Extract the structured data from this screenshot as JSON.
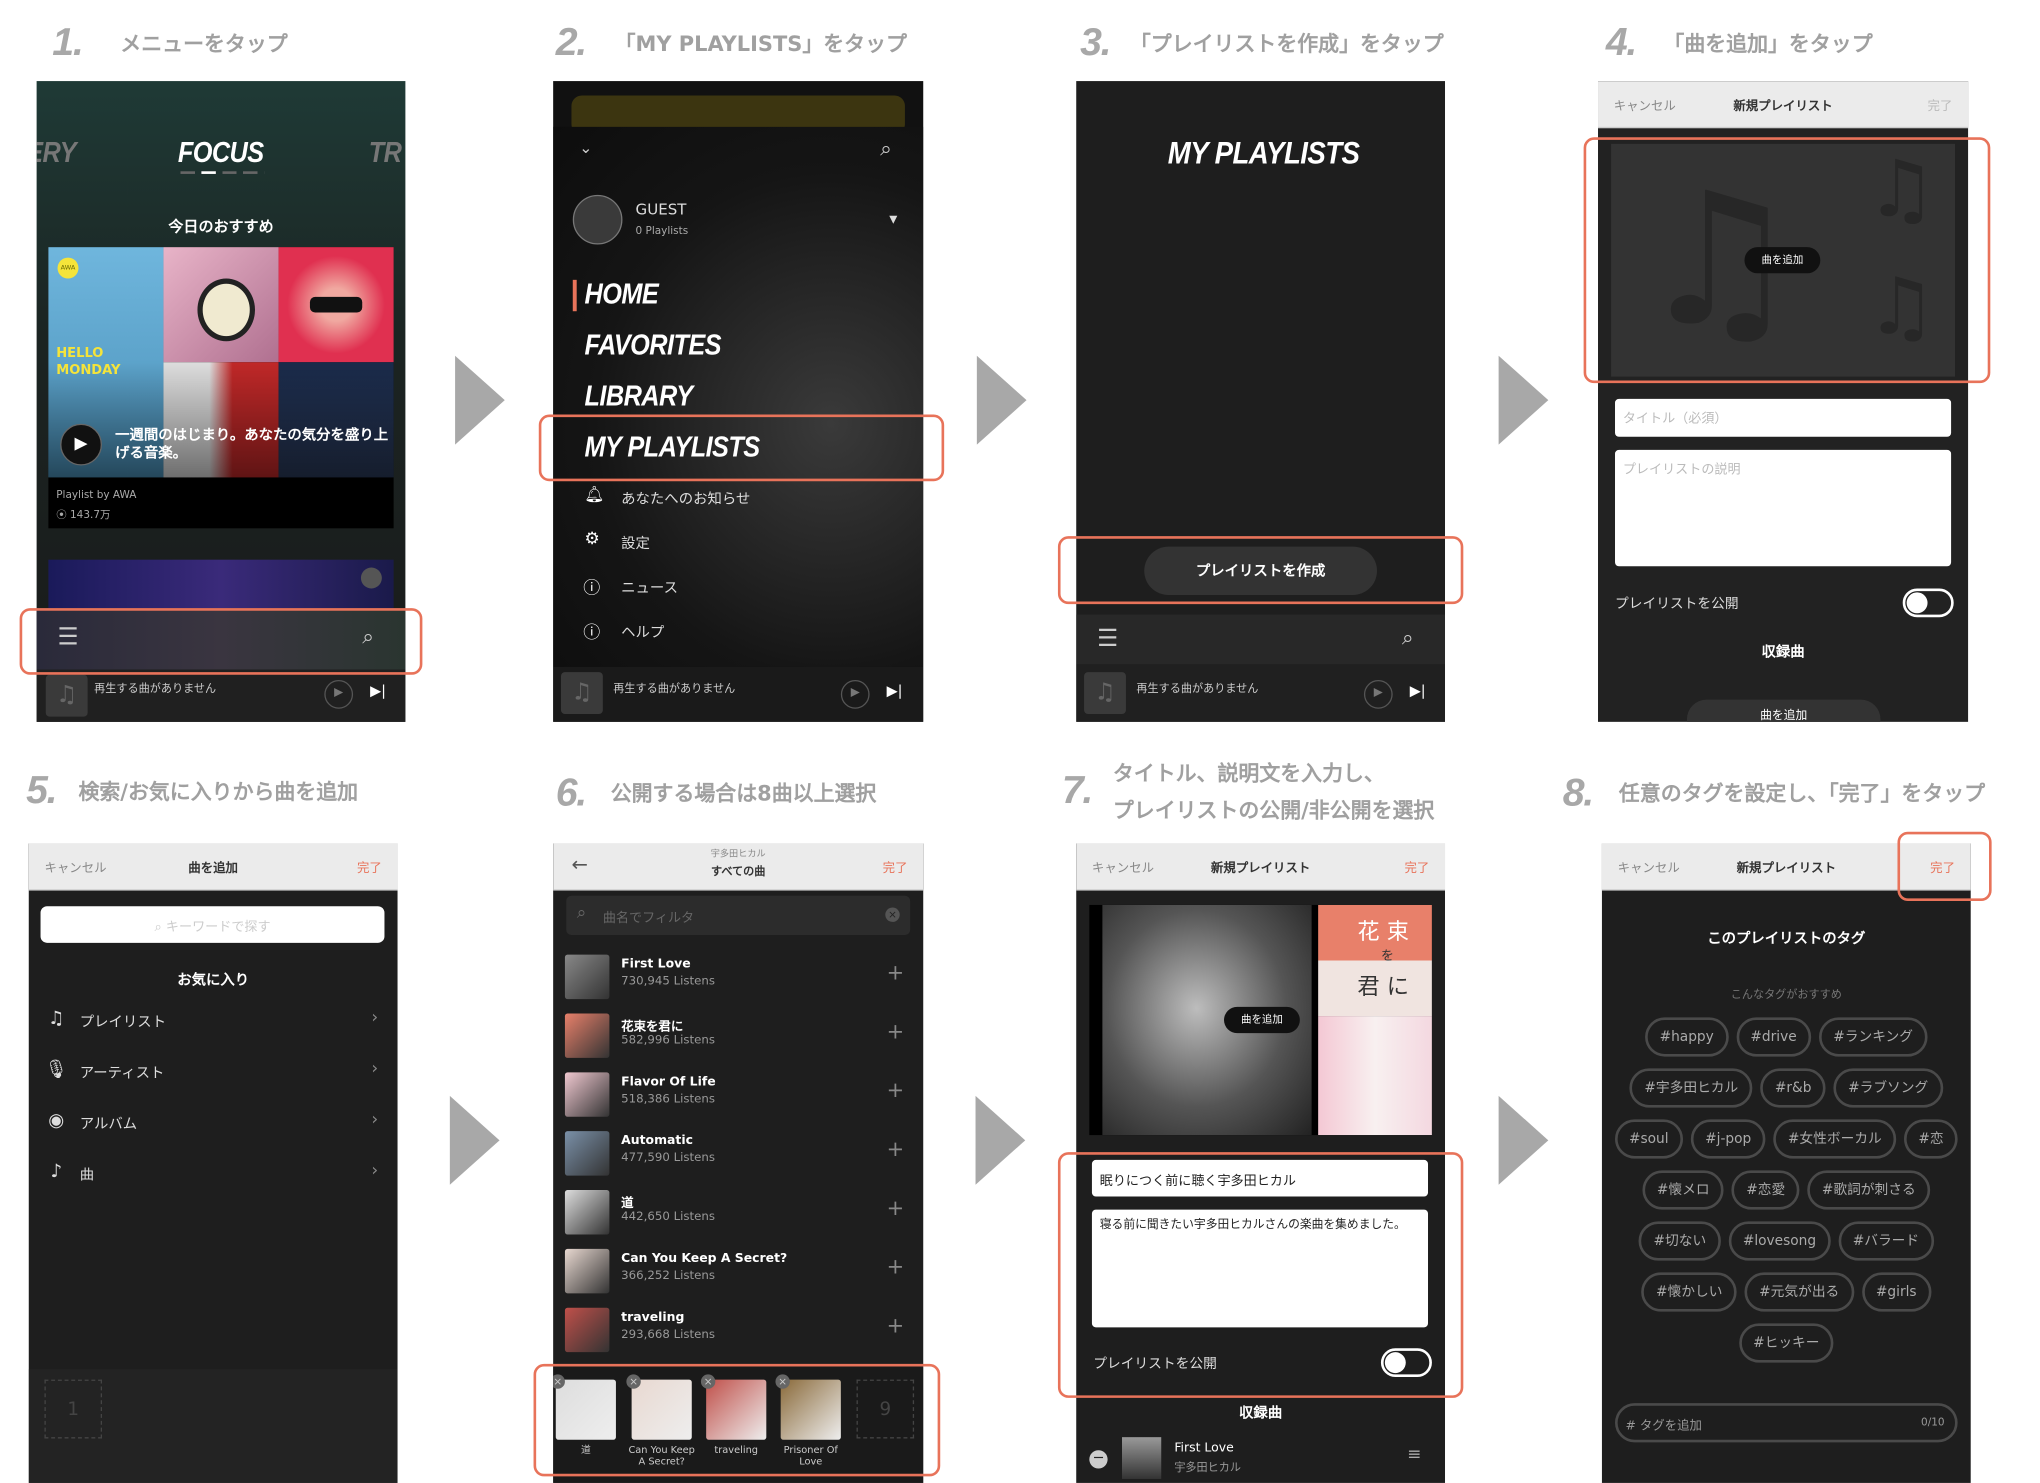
{
  "accent_color": "#e8735a",
  "steps": [
    {
      "num": "1.",
      "text": "メニューをタップ"
    },
    {
      "num": "2.",
      "text": "「MY PLAYLISTS」をタップ"
    },
    {
      "num": "3.",
      "text": "「プレイリストを作成」をタップ"
    },
    {
      "num": "4.",
      "text": "「曲を追加」をタップ"
    },
    {
      "num": "5.",
      "text": "検索/お気に入りから曲を追加"
    },
    {
      "num": "6.",
      "text": "公開する場合は8曲以上選択"
    },
    {
      "num": "7.",
      "text": "タイトル、説明文を入力し、",
      "text2": "プレイリストの公開/非公開を選択"
    },
    {
      "num": "8.",
      "text": "任意のタグを設定し、「完了」をタップ"
    }
  ],
  "screen1": {
    "carousel_prev": "ERY",
    "carousel_current": "FOCUS",
    "carousel_next": "TR",
    "section_title": "今日のおすすめ",
    "badge": "AWA",
    "cover_text": "HELLO\nMONDAY",
    "description": "一週間のはじまり。あなたの気分を盛り上げる音楽。",
    "playlist_by": "Playlist by AWA",
    "plays": "143.7万",
    "player_text": "再生する曲がありません"
  },
  "screen2": {
    "user_name": "GUEST",
    "user_playlists": "0 Playlists",
    "menu": [
      "HOME",
      "FAVORITES",
      "LIBRARY",
      "MY PLAYLISTS"
    ],
    "sub_menu": [
      {
        "icon": "bell-icon",
        "label": "あなたへのお知らせ"
      },
      {
        "icon": "gear-icon",
        "label": "設定"
      },
      {
        "icon": "info-icon",
        "label": "ニュース"
      },
      {
        "icon": "help-icon",
        "label": "ヘルプ"
      }
    ],
    "player_text": "再生する曲がありません"
  },
  "screen3": {
    "title": "MY PLAYLISTS",
    "create_button": "プレイリストを作成",
    "player_text": "再生する曲がありません"
  },
  "screen4": {
    "cancel": "キャンセル",
    "header_title": "新規プレイリスト",
    "done": "完了",
    "add_song_pill": "曲を追加",
    "title_placeholder": "タイトル（必須）",
    "description_placeholder": "プレイリストの説明",
    "public_label": "プレイリストを公開",
    "public_on": false,
    "tracks_title": "収録曲",
    "add_song_button": "曲を追加"
  },
  "screen5": {
    "cancel": "キャンセル",
    "header_title": "曲を追加",
    "done": "完了",
    "search_placeholder": "キーワードで探す",
    "favorites_title": "お気に入り",
    "rows": [
      {
        "icon": "playlist-icon",
        "label": "プレイリスト"
      },
      {
        "icon": "microphone-icon",
        "label": "アーティスト"
      },
      {
        "icon": "album-icon",
        "label": "アルバム"
      },
      {
        "icon": "music-note-icon",
        "label": "曲"
      }
    ],
    "selected_count_slot": "1"
  },
  "screen6": {
    "artist": "宇多田ヒカル",
    "header_title": "すべての曲",
    "done": "完了",
    "filter_placeholder": "曲名でフィルタ",
    "songs": [
      {
        "title": "First Love",
        "listens": "730,945 Listens",
        "color": "#888"
      },
      {
        "title": "花束を君に",
        "listens": "582,996 Listens",
        "color": "#e8806a"
      },
      {
        "title": "Flavor Of Life",
        "listens": "518,386 Listens",
        "color": "#f0c8d0"
      },
      {
        "title": "Automatic",
        "listens": "477,590 Listens",
        "color": "#7a90a8"
      },
      {
        "title": "道",
        "listens": "442,650 Listens",
        "color": "#ddd"
      },
      {
        "title": "Can You Keep A Secret?",
        "listens": "366,252 Listens",
        "color": "#e8d8d0"
      },
      {
        "title": "traveling",
        "listens": "293,668 Listens",
        "color": "#c0504a"
      }
    ],
    "selected": [
      {
        "title": "道",
        "color": "#ddd"
      },
      {
        "title": "Can You Keep A Secret?",
        "color": "#e8d8d0"
      },
      {
        "title": "traveling",
        "color": "#c0504a"
      },
      {
        "title": "Prisoner Of Love",
        "color": "#8a6a3a"
      }
    ],
    "next_slot": "9"
  },
  "screen7": {
    "cancel": "キャンセル",
    "header_title": "新規プレイリスト",
    "done": "完了",
    "add_song_pill": "曲を追加",
    "album_text_1": "花 束",
    "album_text_2": "を",
    "album_text_3": "君 に",
    "title_value": "眠りにつく前に聴く宇多田ヒカル",
    "description_value": "寝る前に聞きたい宇多田ヒカルさんの楽曲を集めました。",
    "public_label": "プレイリストを公開",
    "public_on": false,
    "tracks_title": "収録曲",
    "track": {
      "title": "First Love",
      "artist": "宇多田ヒカル"
    }
  },
  "screen8": {
    "cancel": "キャンセル",
    "header_title": "新規プレイリスト",
    "done": "完了",
    "tags_title": "このプレイリストのタグ",
    "suggest_label": "こんなタグがおすすめ",
    "tag_rows": [
      [
        "#happy",
        "#drive",
        "#ランキング"
      ],
      [
        "#宇多田ヒカル",
        "#r&b",
        "#ラブソング"
      ],
      [
        "#soul",
        "#j-pop",
        "#女性ボーカル",
        "#恋"
      ],
      [
        "#懐メロ",
        "#恋愛",
        "#歌詞が刺さる"
      ],
      [
        "#切ない",
        "#lovesong",
        "#バラード"
      ],
      [
        "#懐かしい",
        "#元気が出る",
        "#girls"
      ],
      [
        "#ヒッキー"
      ]
    ],
    "add_tag_placeholder": "# タグを追加",
    "tag_count": "0/10"
  }
}
